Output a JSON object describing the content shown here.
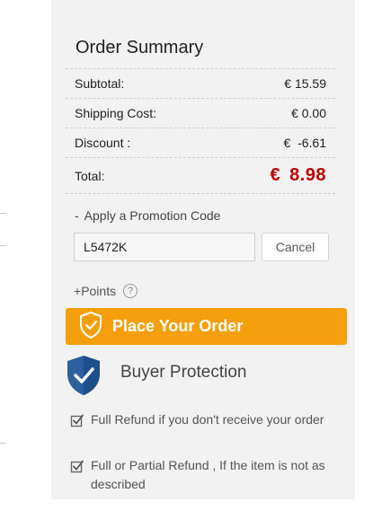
{
  "summary": {
    "title": "Order Summary",
    "rows": [
      {
        "label": "Subtotal:",
        "value": "€ 15.59"
      },
      {
        "label": "Shipping Cost:",
        "value": "€ 0.00"
      },
      {
        "label": "Discount :",
        "value": "€  -6.61"
      }
    ],
    "total": {
      "label": "Total:",
      "currency": "€",
      "amount": "8.98"
    }
  },
  "promotion": {
    "toggle_symbol": "-",
    "toggle_label": "Apply a Promotion Code",
    "code_value": "L5472K",
    "cancel_label": "Cancel"
  },
  "points": {
    "prefix": "+",
    "label": "Points",
    "help_symbol": "?"
  },
  "place_order": {
    "label": "Place Your Order",
    "color": "#f59f0c"
  },
  "buyer_protection": {
    "title": "Buyer Protection",
    "shield_color": "#2b5f9e",
    "items": [
      {
        "text": "Full Refund if you don't receive your order"
      },
      {
        "text": "Full or Partial Refund , If the item is not as described"
      }
    ]
  },
  "colors": {
    "panel_bg": "#f2f2f2",
    "total_red": "#c00000"
  }
}
